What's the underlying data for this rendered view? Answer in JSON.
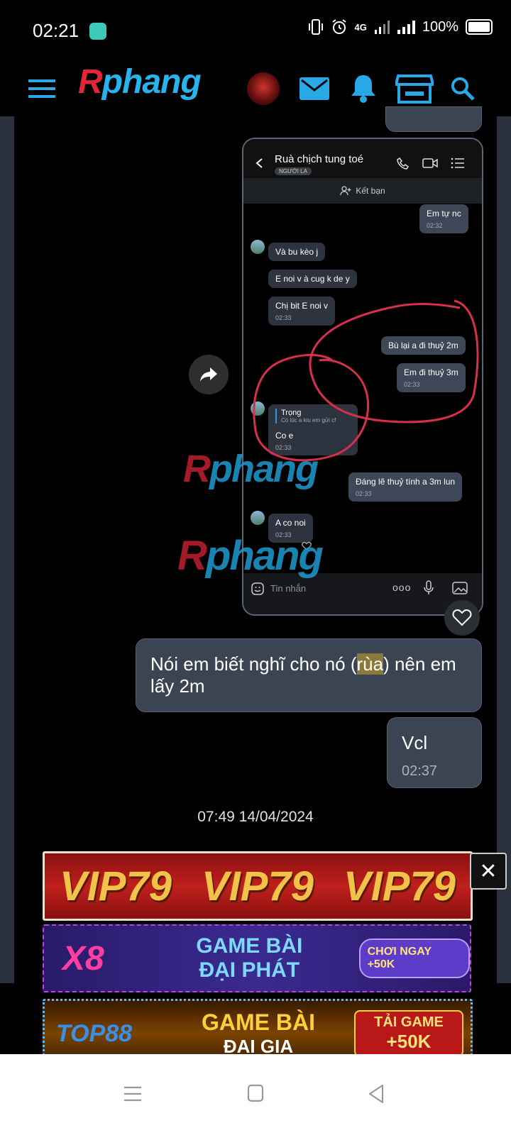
{
  "status_bar": {
    "time": "02:21",
    "network": "4G",
    "battery": "100%"
  },
  "header": {
    "logo": {
      "r": "R",
      "rest": "phang"
    },
    "icons": [
      "menu-icon",
      "avatar",
      "mail-icon",
      "bell-icon",
      "store-icon",
      "search-icon"
    ]
  },
  "inner_screenshot": {
    "contact_name": "Ruà chịch tung toé",
    "contact_badge": "NGƯỜI LẠ",
    "add_friend": "Kết bạn",
    "messages": [
      {
        "side": "me",
        "text": "Em tự nc",
        "time": "02:32"
      },
      {
        "side": "them",
        "text": "Và bu kèo j"
      },
      {
        "side": "them",
        "text": "E noi v à cug k de y"
      },
      {
        "side": "them",
        "text": "Chị bit E noi v",
        "time": "02:33"
      },
      {
        "side": "me",
        "text": "Bù lại a đi thuỷ 2m"
      },
      {
        "side": "me",
        "text": "Em đi thuỷ 3m",
        "time": "02:33"
      },
      {
        "side": "them",
        "reply_name": "Trọng",
        "reply_text": "Có lúc a kiu em gửi cf",
        "text": "Co e",
        "time": "02:33"
      },
      {
        "side": "me",
        "text": "Đáng lẽ thuỷ tính a 3m lun",
        "time": "02:33"
      },
      {
        "side": "them",
        "text": "A co noi",
        "time": "02:33"
      }
    ],
    "input_placeholder": "Tin nhắn",
    "more": "ooo"
  },
  "watermark": {
    "r": "R",
    "rest": "phang"
  },
  "chat": {
    "bubble1_before": "Nói em biết nghĩ cho nó (",
    "bubble1_highlight": "rùa",
    "bubble1_after": ") nên em lấy 2m",
    "bubble2_text": "Vcl",
    "bubble2_time": "02:37",
    "date_separator": "07:49 14/04/2024"
  },
  "ads": {
    "vip": {
      "text": "VIP79",
      "close": "✕"
    },
    "x8": {
      "brand": "X8",
      "line1": "GAME BÀI",
      "line2": "ĐẠI PHÁT",
      "cta": "CHƠI NGAY +50K"
    },
    "top88": {
      "brand": "TOP88",
      "line1": "GAME BÀI",
      "line2": "ĐẠI GIA",
      "cta1": "TẢI GAME",
      "cta2": "+50K"
    }
  },
  "colors": {
    "accent": "#29a8e8",
    "logo_red": "#e3263a",
    "bubble": "#3a4452",
    "highlight": "#8a7a3a",
    "annotation_red": "#d6304a"
  }
}
